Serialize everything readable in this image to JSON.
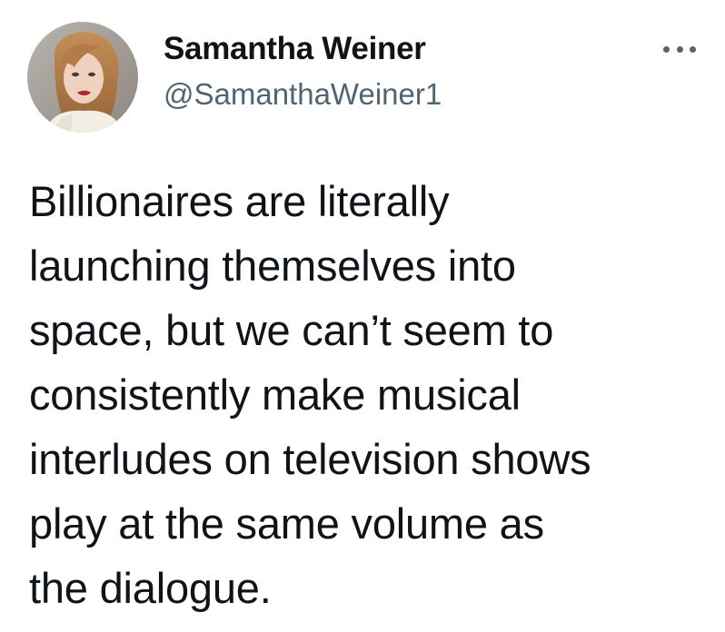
{
  "tweet": {
    "author": {
      "display_name": "Samantha Weiner",
      "handle": "@SamanthaWeiner1",
      "avatar_icon": "profile-photo"
    },
    "more_icon": "more-horizontal-icon",
    "text_lines": [
      "Billionaires are literally",
      "launching themselves into",
      "space, but we can’t seem to",
      "consistently make musical",
      "interludes on television shows",
      "play at the same volume as",
      "the dialogue."
    ]
  },
  "colors": {
    "text_primary": "#0f1419",
    "text_secondary": "#536471",
    "background": "#ffffff"
  }
}
